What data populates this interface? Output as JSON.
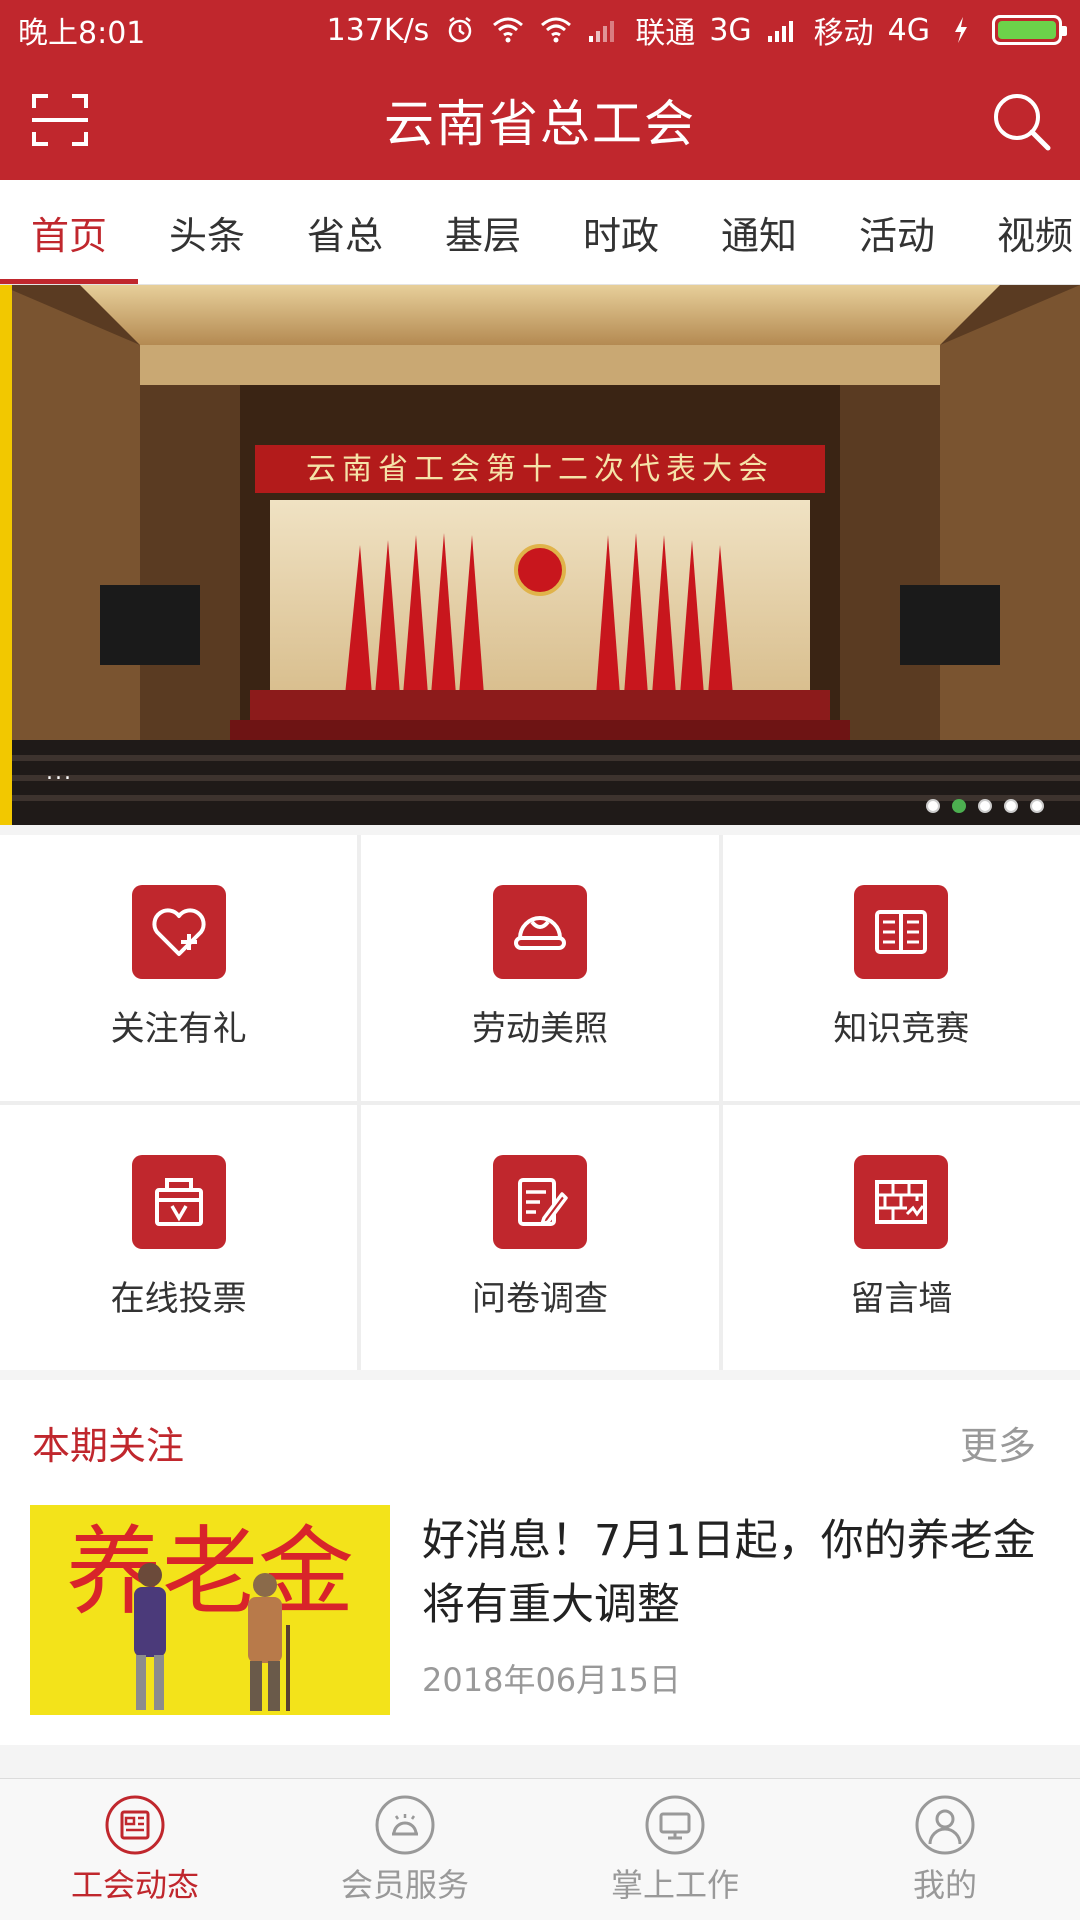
{
  "status_bar": {
    "time": "晚上8:01",
    "speed": "137K/s",
    "carrier1": "联通",
    "net1": "3G",
    "carrier2": "移动",
    "net2": "4G"
  },
  "app_bar": {
    "title": "云南省总工会"
  },
  "tabs": [
    "首页",
    "头条",
    "省总",
    "基层",
    "时政",
    "通知",
    "活动",
    "视频"
  ],
  "banner": {
    "caption": "云南省工会第十二次代表大会",
    "ellipsis": "...",
    "dots_total": 5,
    "dots_active": 2
  },
  "grid": [
    {
      "label": "关注有礼",
      "icon": "heart-plus-icon"
    },
    {
      "label": "劳动美照",
      "icon": "hardhat-icon"
    },
    {
      "label": "知识竞赛",
      "icon": "book-icon"
    },
    {
      "label": "在线投票",
      "icon": "ballot-box-icon"
    },
    {
      "label": "问卷调查",
      "icon": "survey-icon"
    },
    {
      "label": "留言墙",
      "icon": "brick-wall-icon"
    }
  ],
  "section": {
    "title": "本期关注",
    "more": "更多",
    "news": {
      "title": "好消息！7月1日起，你的养老金将有重大调整",
      "date": "2018年06月15日",
      "thumb_text": "养老金"
    }
  },
  "bottom_nav": [
    {
      "label": "工会动态",
      "icon": "news-icon",
      "active": true
    },
    {
      "label": "会员服务",
      "icon": "service-bell-icon",
      "active": false
    },
    {
      "label": "掌上工作",
      "icon": "monitor-icon",
      "active": false
    },
    {
      "label": "我的",
      "icon": "user-icon",
      "active": false
    }
  ],
  "colors": {
    "primary": "#c0272d",
    "accent_green": "#4caf50"
  }
}
